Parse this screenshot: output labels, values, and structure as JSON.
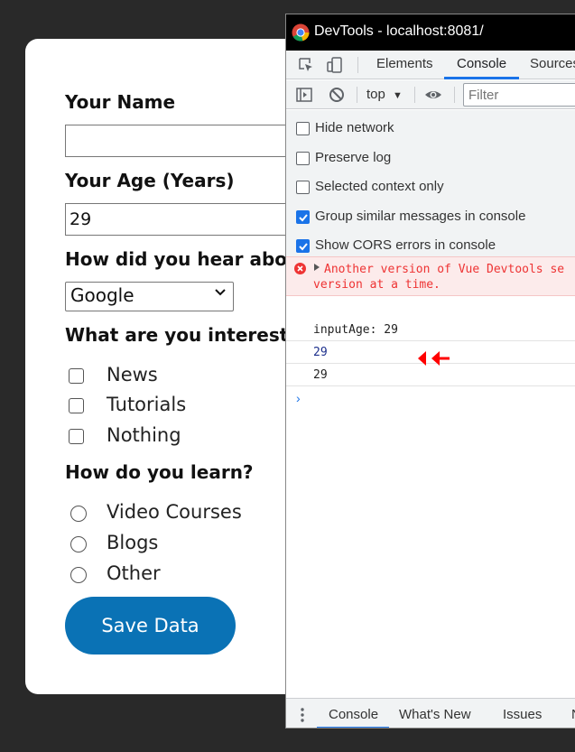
{
  "form": {
    "name_label": "Your Name",
    "name_value": "",
    "age_label": "Your Age (Years)",
    "age_value": "29",
    "referrer_label": "How did you hear abou",
    "referrer_selected": "Google",
    "interest_label": "What are you intereste",
    "interests": [
      "News",
      "Tutorials",
      "Nothing"
    ],
    "learn_label": "How do you learn?",
    "learn_options": [
      "Video Courses",
      "Blogs",
      "Other"
    ],
    "save_label": "Save Data"
  },
  "devtools": {
    "title": "DevTools - localhost:8081/",
    "tabs": [
      "Elements",
      "Console",
      "Sources"
    ],
    "active_tab": "Console",
    "context": "top",
    "filter_placeholder": "Filter",
    "settings": [
      {
        "label": "Hide network",
        "checked": false
      },
      {
        "label": "Preserve log",
        "checked": false
      },
      {
        "label": "Selected context only",
        "checked": false
      },
      {
        "label": "Group similar messages in console",
        "checked": true
      },
      {
        "label": "Show CORS errors in console",
        "checked": true
      }
    ],
    "error_line1": "Another version of Vue Devtools se",
    "error_line2": "version at a time.",
    "logs": [
      "inputAge: 29",
      "29",
      "29"
    ],
    "drawer_tabs": [
      "Console",
      "What's New",
      "Issues",
      "N"
    ]
  },
  "colors": {
    "accent": "#1a73e8",
    "save_button": "#0a72b5",
    "error_text": "#ee3333",
    "annotation_arrow": "#ff0000"
  }
}
